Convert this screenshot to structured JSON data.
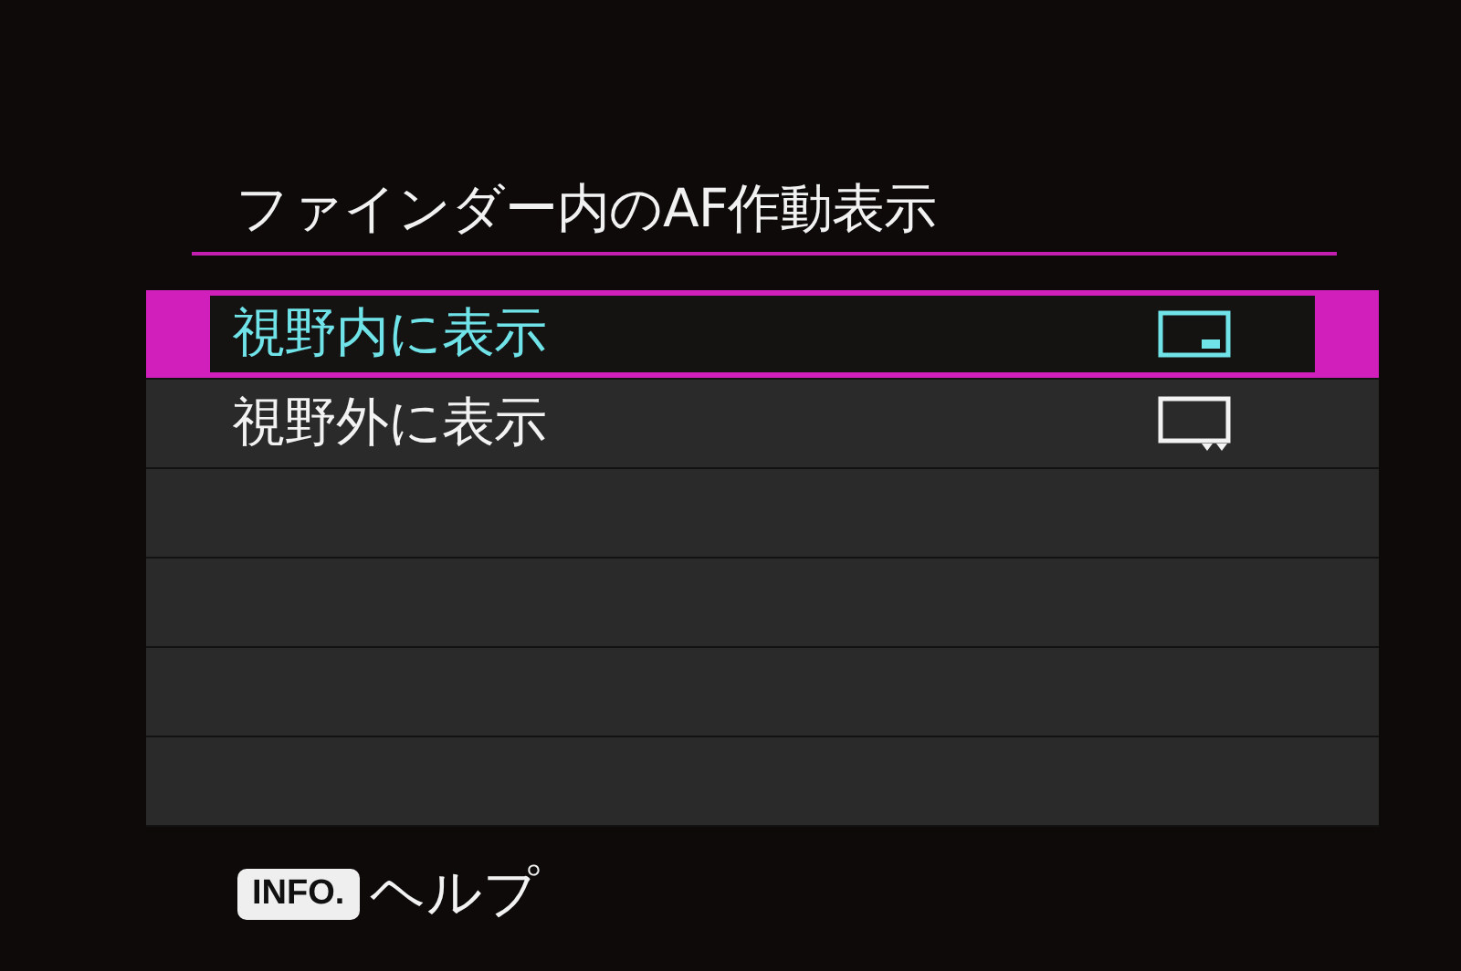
{
  "title": "ファインダー内のAF作動表示",
  "options": [
    {
      "label": "視野内に表示",
      "selected": true,
      "kind": "inside"
    },
    {
      "label": "視野外に表示",
      "selected": false,
      "kind": "outside"
    }
  ],
  "footer": {
    "key": "INFO.",
    "label": "ヘルプ"
  }
}
